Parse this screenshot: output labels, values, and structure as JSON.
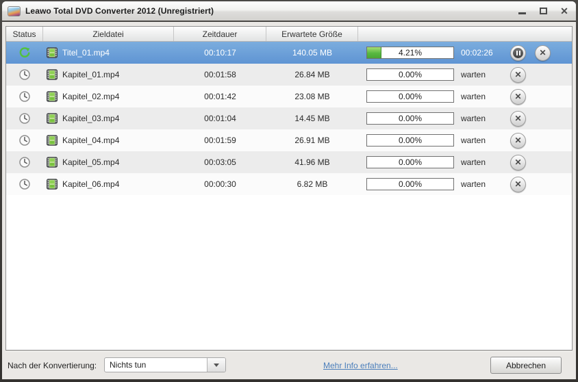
{
  "window": {
    "title": "Leawo Total DVD Converter 2012 (Unregistriert)"
  },
  "table": {
    "columns": [
      "Status",
      "Zieldatei",
      "Zeitdauer",
      "Erwartete Größe",
      ""
    ],
    "rows": [
      {
        "status": "converting",
        "file": "Titel_01.mp4",
        "duration": "00:10:17",
        "size": "140.05 MB",
        "progress_label": "4.21%",
        "progress_fill": 17,
        "state": "00:02:26",
        "selected": true,
        "has_pause": true
      },
      {
        "status": "waiting",
        "file": "Kapitel_01.mp4",
        "duration": "00:01:58",
        "size": "26.84 MB",
        "progress_label": "0.00%",
        "progress_fill": 0,
        "state": "warten",
        "selected": false,
        "has_pause": false
      },
      {
        "status": "waiting",
        "file": "Kapitel_02.mp4",
        "duration": "00:01:42",
        "size": "23.08 MB",
        "progress_label": "0.00%",
        "progress_fill": 0,
        "state": "warten",
        "selected": false,
        "has_pause": false
      },
      {
        "status": "waiting",
        "file": "Kapitel_03.mp4",
        "duration": "00:01:04",
        "size": "14.45 MB",
        "progress_label": "0.00%",
        "progress_fill": 0,
        "state": "warten",
        "selected": false,
        "has_pause": false
      },
      {
        "status": "waiting",
        "file": "Kapitel_04.mp4",
        "duration": "00:01:59",
        "size": "26.91 MB",
        "progress_label": "0.00%",
        "progress_fill": 0,
        "state": "warten",
        "selected": false,
        "has_pause": false
      },
      {
        "status": "waiting",
        "file": "Kapitel_05.mp4",
        "duration": "00:03:05",
        "size": "41.96 MB",
        "progress_label": "0.00%",
        "progress_fill": 0,
        "state": "warten",
        "selected": false,
        "has_pause": false
      },
      {
        "status": "waiting",
        "file": "Kapitel_06.mp4",
        "duration": "00:00:30",
        "size": "6.82 MB",
        "progress_label": "0.00%",
        "progress_fill": 0,
        "state": "warten",
        "selected": false,
        "has_pause": false
      }
    ]
  },
  "footer": {
    "after_conversion_label": "Nach der Konvertierung:",
    "dropdown_value": "Nichts tun",
    "link_label": "Mehr Info erfahren...",
    "cancel_label": "Abbrechen"
  },
  "colors": {
    "selected_row_blue": "#639ad6",
    "progress_green": "#58b840",
    "link_blue": "#4a7ebb"
  }
}
